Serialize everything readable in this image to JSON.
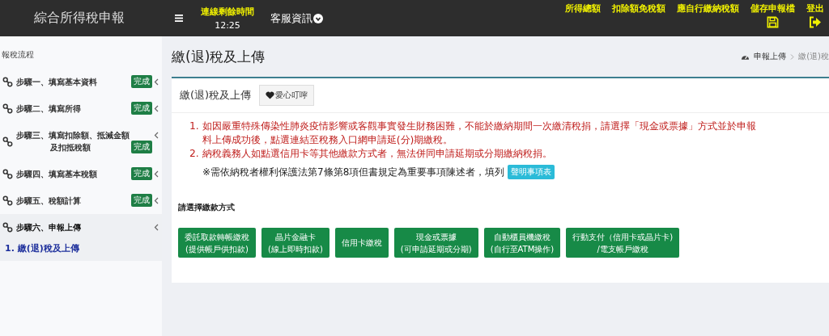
{
  "header": {
    "title": "綜合所得稅申報",
    "timer_label": "連線剩餘時間",
    "timer": "12:25",
    "service": "客服資訊",
    "links": [
      {
        "label": "所得總額",
        "kind": "text"
      },
      {
        "label": "扣除額免稅額",
        "kind": "text"
      },
      {
        "label": "應自行繳納稅額",
        "kind": "text"
      },
      {
        "label": "儲存申報檔",
        "kind": "save"
      },
      {
        "label": "登出",
        "kind": "logout"
      }
    ]
  },
  "sidebar": {
    "heading": "報稅流程",
    "steps": [
      {
        "label": "步驟一、填寫基本資料",
        "badge": "完成",
        "selected": false
      },
      {
        "label": "步驟二、填寫所得",
        "badge": "完成",
        "selected": false
      },
      {
        "label": "步驟三、填寫扣除額、抵減金額及扣抵稅額",
        "badge": "完成",
        "selected": false
      },
      {
        "label": "步驟四、填寫基本稅額",
        "badge": "完成",
        "selected": false
      },
      {
        "label": "步驟五、稅額計算",
        "badge": "完成",
        "selected": false
      },
      {
        "label": "步驟六、申報上傳",
        "selected": true,
        "children": [
          {
            "label": "1. 繳(退)稅及上傳"
          }
        ]
      }
    ]
  },
  "page": {
    "title": "繳(退)稅及上傳",
    "breadcrumb": [
      "申報上傳",
      "繳(退)稅"
    ]
  },
  "card": {
    "title": "繳(退)稅及上傳",
    "reminder_button": "愛心叮嚀",
    "notices": [
      {
        "number": "1.",
        "lines": [
          "如因嚴重特殊傳染性肺炎疫情影響或客觀事實發生財務困難，不能於繳納期間一次繳清稅捐，請選擇「現金或票據」方式並於申報",
          "料上傳成功後，點選連結至稅務入口網申請延(分)期繳稅。"
        ]
      },
      {
        "number": "2.",
        "lines": [
          "納稅義務人如點選信用卡等其他繳款方式者，無法併同申請延期或分期繳納稅捐。"
        ]
      }
    ],
    "note": "※需依納稅者權利保護法第7條第8項但書規定為重要事項陳述者，填列",
    "note_button": "聲明事項表",
    "payment_heading": "請選擇繳款方式",
    "payment_methods": [
      {
        "lines": [
          "委託取款轉帳繳稅",
          "(提供帳戶供扣款)"
        ]
      },
      {
        "lines": [
          "晶片金融卡",
          "(線上即時扣款)"
        ]
      },
      {
        "lines": [
          "信用卡繳稅"
        ]
      },
      {
        "lines": [
          "現金或票據",
          "(可申請延期或分期)"
        ]
      },
      {
        "lines": [
          "自動櫃員機繳稅",
          "(自行至ATM操作)"
        ]
      },
      {
        "lines": [
          "行動支付（信用卡或晶片卡)",
          "/電支帳戶繳稅"
        ]
      }
    ]
  }
}
